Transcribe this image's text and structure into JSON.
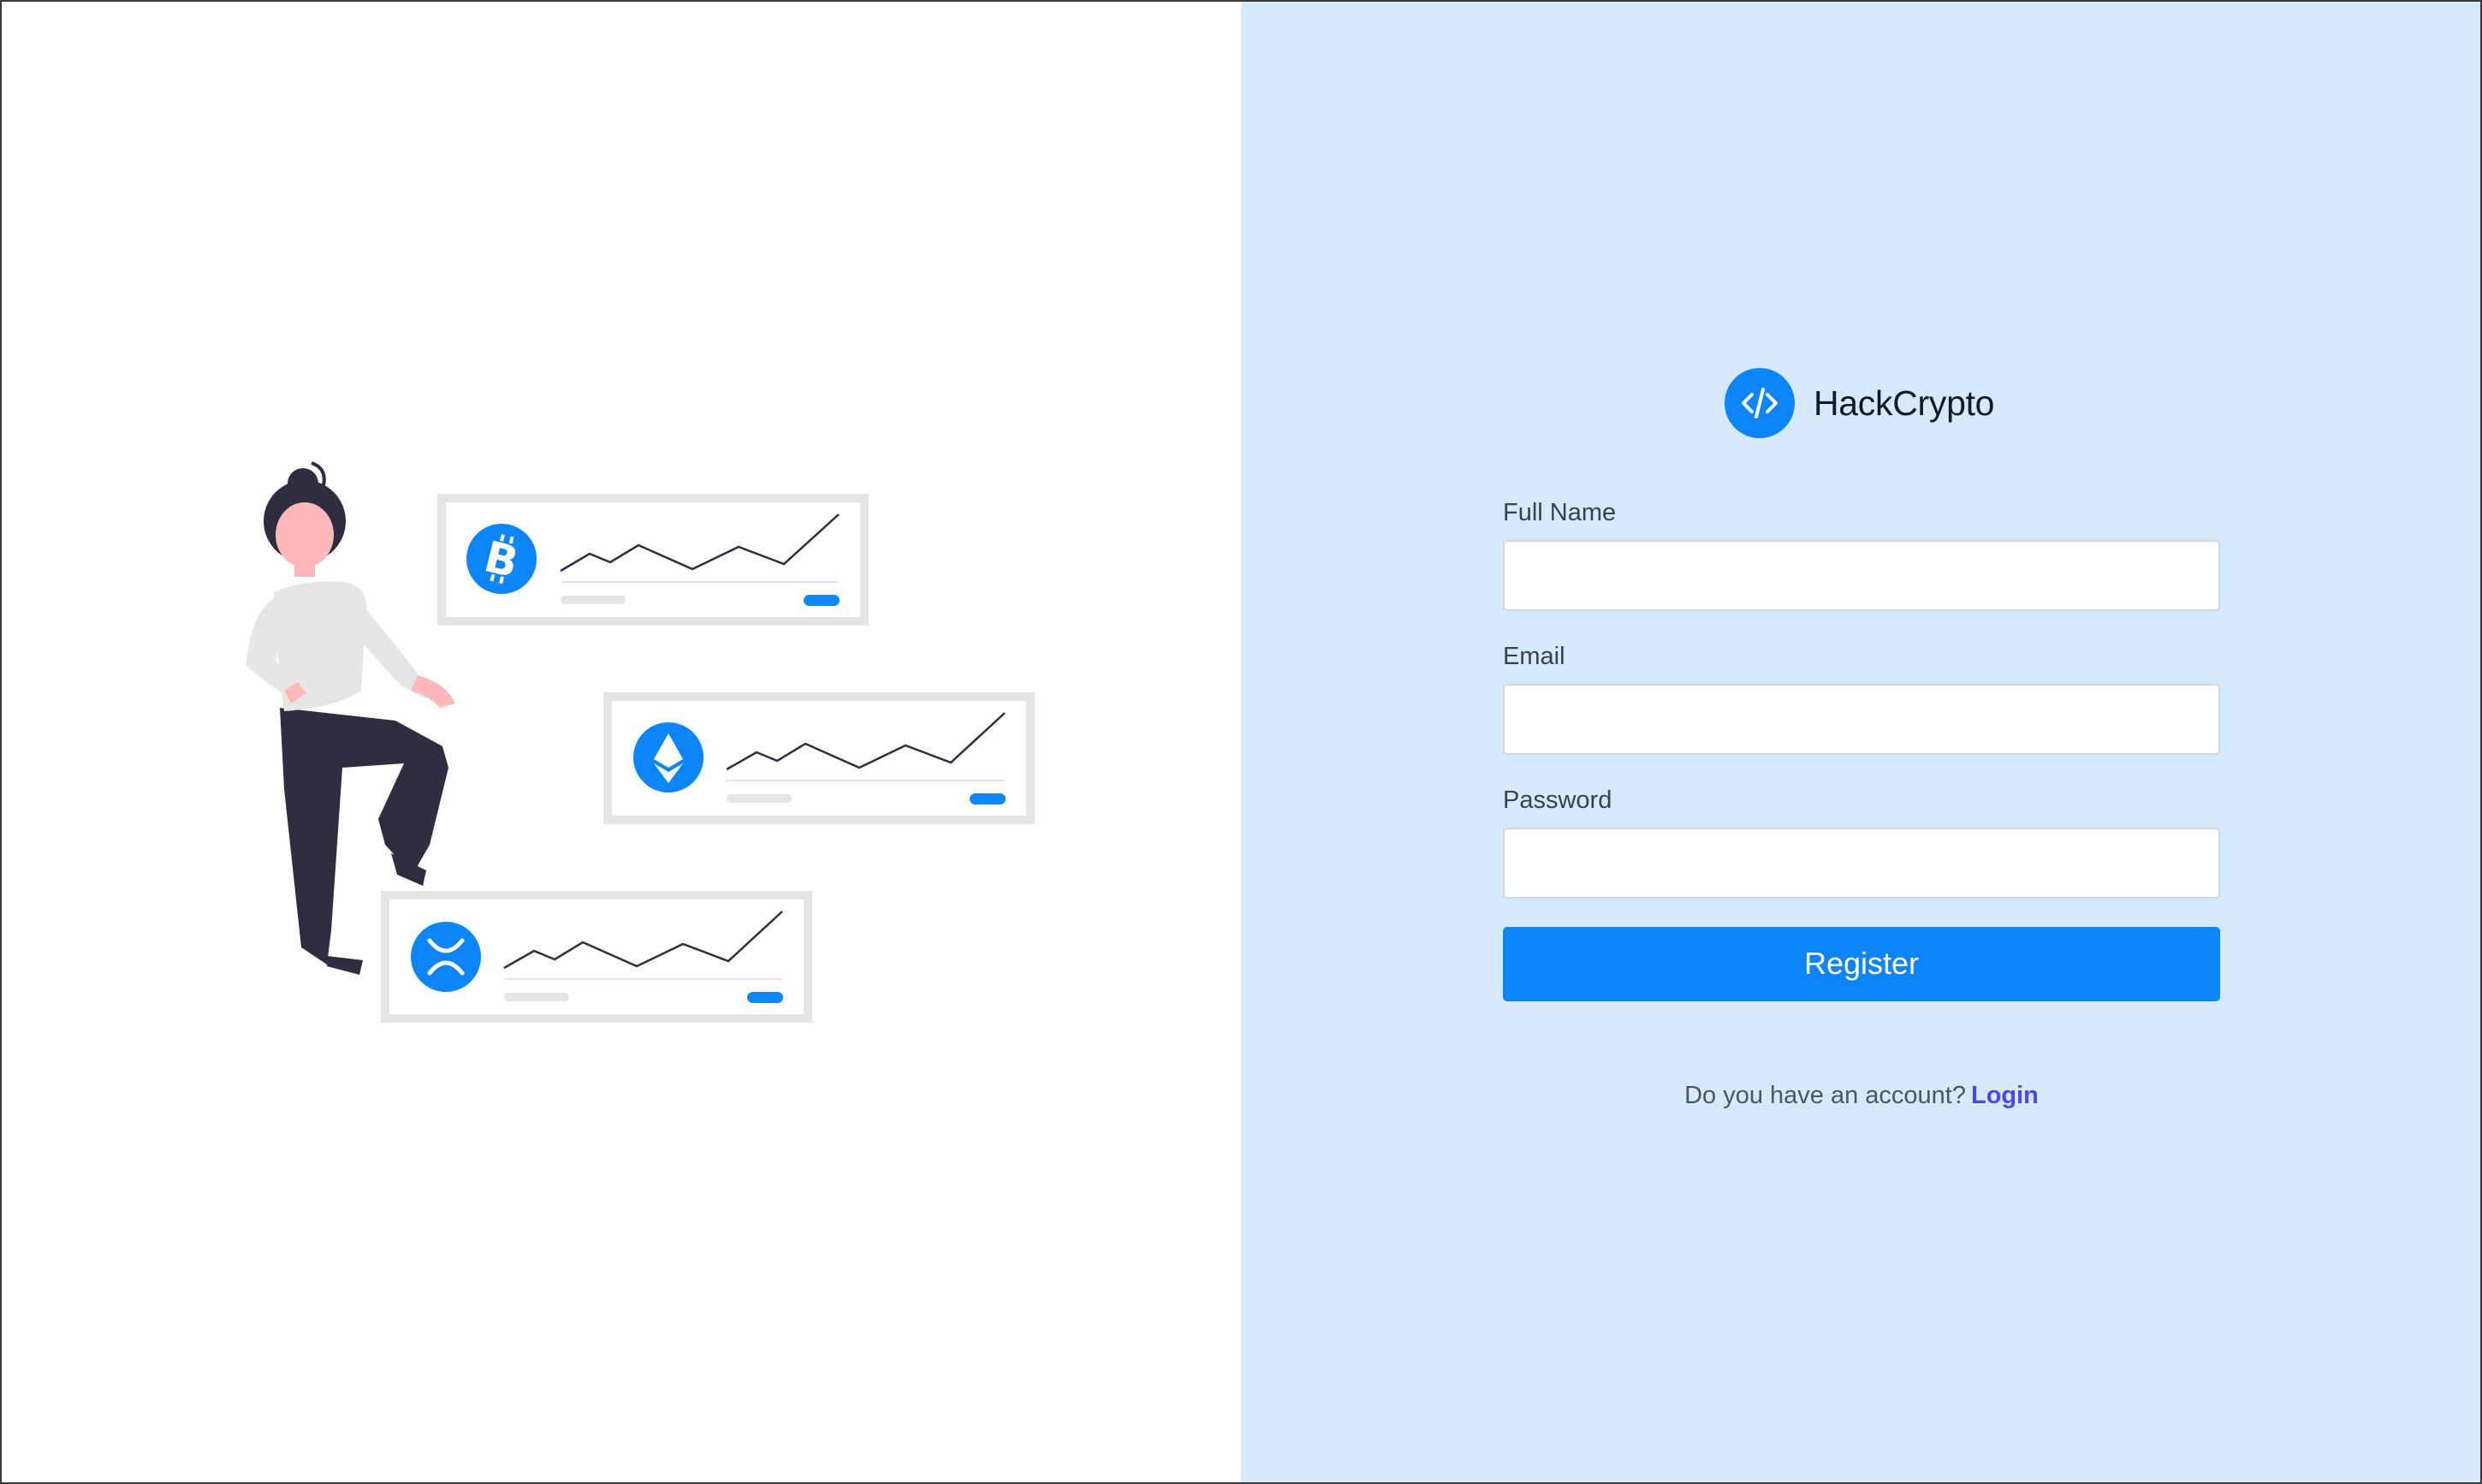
{
  "brand": {
    "name": "HackCrypto",
    "logo_icon": "code-icon",
    "accent_color": "#0d84f7"
  },
  "illustration": {
    "cards": [
      {
        "coin_icon": "bitcoin-icon"
      },
      {
        "coin_icon": "ethereum-icon"
      },
      {
        "coin_icon": "ripple-icon"
      }
    ]
  },
  "form": {
    "full_name_label": "Full Name",
    "full_name_value": "",
    "email_label": "Email",
    "email_value": "",
    "password_label": "Password",
    "password_value": "",
    "register_label": "Register"
  },
  "footer": {
    "account_prompt": "Do you have an account?",
    "login_label": "Login"
  },
  "colors": {
    "right_panel_bg": "#d7e9fd",
    "link_color": "#4f46e5"
  }
}
